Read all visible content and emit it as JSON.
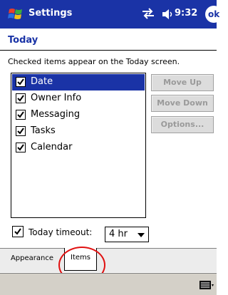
{
  "titlebar": {
    "app_title": "Settings",
    "time": "9:32",
    "ok_label": "ok"
  },
  "page": {
    "heading": "Today",
    "instruction": "Checked items appear on the Today screen."
  },
  "list_items": [
    {
      "label": "Date",
      "checked": true,
      "selected": true
    },
    {
      "label": "Owner Info",
      "checked": true,
      "selected": false
    },
    {
      "label": "Messaging",
      "checked": true,
      "selected": false
    },
    {
      "label": "Tasks",
      "checked": true,
      "selected": false
    },
    {
      "label": "Calendar",
      "checked": true,
      "selected": false
    }
  ],
  "buttons": {
    "move_up": "Move Up",
    "move_down": "Move Down",
    "options": "Options..."
  },
  "timeout": {
    "label": "Today timeout:",
    "checked": true,
    "value": "4 hr"
  },
  "tabs": [
    {
      "label": "Appearance",
      "active": false
    },
    {
      "label": "Items",
      "active": true
    }
  ],
  "icons": {
    "start": "windows-flag-icon",
    "sync": "connectivity-icon",
    "volume": "speaker-icon",
    "keyboard": "keyboard-icon"
  },
  "colors": {
    "accent": "#1a33a6",
    "highlight_circle": "#e01010"
  }
}
